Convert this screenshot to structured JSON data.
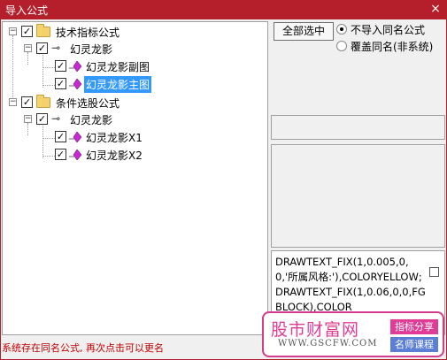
{
  "window": {
    "title": "导入公式",
    "close_glyph": "×"
  },
  "tree": {
    "groups": [
      {
        "label": "技术指标公式",
        "checked": true,
        "expanded": true,
        "children": [
          {
            "label": "幻灵龙影",
            "checked": true,
            "expanded": true,
            "children": [
              {
                "label": "幻灵龙影副图",
                "checked": true,
                "selected": false
              },
              {
                "label": "幻灵龙影主图",
                "checked": true,
                "selected": true
              }
            ]
          }
        ]
      },
      {
        "label": "条件选股公式",
        "checked": true,
        "expanded": true,
        "children": [
          {
            "label": "幻灵龙影",
            "checked": true,
            "expanded": true,
            "children": [
              {
                "label": "幻灵龙影X1",
                "checked": true,
                "selected": false
              },
              {
                "label": "幻灵龙影X2",
                "checked": true,
                "selected": false
              }
            ]
          }
        ]
      }
    ],
    "expander_glyph": "−",
    "check_glyph": "✓",
    "key_glyph": "⊸"
  },
  "options": {
    "select_all_label": "全部选中",
    "radio_skip_label": "不导入同名公式",
    "radio_overwrite_label": "覆盖同名(非系统)",
    "selected_radio": "skip"
  },
  "code": {
    "text": "DRAWTEXT_FIX(1,0.005,0,0,'所属风格:'),COLORYELLOW;\nDRAWTEXT_FIX(1,0.06,0,0,FGBLOCK),COLOR"
  },
  "status_text": "系统存在同名公式, 再次点击可以更名",
  "watermark": {
    "title": "股市财富网",
    "url": "WWW.GSCFW.COM",
    "tag1": "指标分享",
    "tag2": "名师课程"
  },
  "colors": {
    "titlebar": "#b51f2b",
    "selection": "#3399ff",
    "status": "#c00000",
    "watermark_pink": "#e03c96",
    "watermark_blue": "#5b7fd6"
  }
}
